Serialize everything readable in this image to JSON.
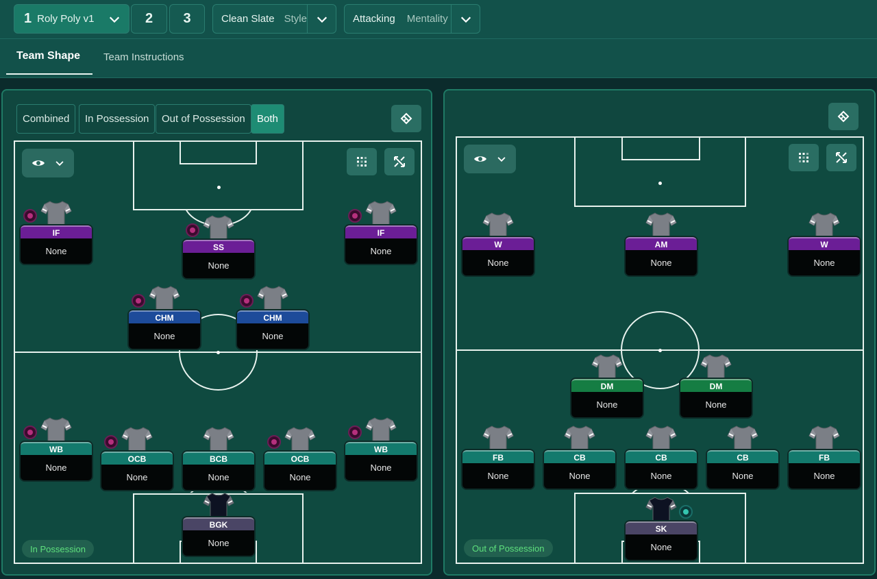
{
  "tactic": {
    "num": "1",
    "name": "Roly Poly v1",
    "slot2": "2",
    "slot3": "3"
  },
  "style": {
    "value": "Clean Slate",
    "label": "Style"
  },
  "mentality": {
    "value": "Attacking",
    "label": "Mentality"
  },
  "tabs": {
    "shape": "Team Shape",
    "instructions": "Team Instructions"
  },
  "filters": {
    "combined": "Combined",
    "in": "In Possession",
    "out": "Out of Possession",
    "both": "Both"
  },
  "left": {
    "label": "In Possession",
    "players": [
      {
        "role": "IF",
        "name": "None"
      },
      {
        "role": "SS",
        "name": "None"
      },
      {
        "role": "IF",
        "name": "None"
      },
      {
        "role": "CHM",
        "name": "None"
      },
      {
        "role": "CHM",
        "name": "None"
      },
      {
        "role": "WB",
        "name": "None"
      },
      {
        "role": "OCB",
        "name": "None"
      },
      {
        "role": "BCB",
        "name": "None"
      },
      {
        "role": "OCB",
        "name": "None"
      },
      {
        "role": "WB",
        "name": "None"
      },
      {
        "role": "BGK",
        "name": "None"
      }
    ]
  },
  "right": {
    "label": "Out of Possession",
    "players": [
      {
        "role": "W",
        "name": "None"
      },
      {
        "role": "AM",
        "name": "None"
      },
      {
        "role": "W",
        "name": "None"
      },
      {
        "role": "DM",
        "name": "None"
      },
      {
        "role": "DM",
        "name": "None"
      },
      {
        "role": "FB",
        "name": "None"
      },
      {
        "role": "CB",
        "name": "None"
      },
      {
        "role": "CB",
        "name": "None"
      },
      {
        "role": "CB",
        "name": "None"
      },
      {
        "role": "FB",
        "name": "None"
      },
      {
        "role": "SK",
        "name": "None"
      }
    ]
  },
  "colors": {
    "accent": "#1e8c74",
    "purple": "#6b1e96",
    "blue": "#1d4b9a",
    "teal": "#137a6d",
    "green": "#157d43",
    "gk": "#4a4565"
  },
  "icons": [
    "chevron-down-icon",
    "eye-icon",
    "tactic-board-icon",
    "grid-icon",
    "expand-icon",
    "shirt-icon",
    "star-badge-icon"
  ]
}
